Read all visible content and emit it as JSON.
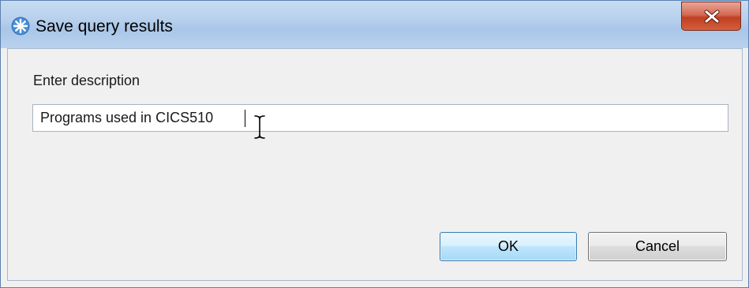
{
  "dialog": {
    "title": "Save query results",
    "icon": "asterisk-star-icon",
    "close_icon": "close-icon"
  },
  "form": {
    "description_label": "Enter description",
    "description_value": "Programs used in CICS510"
  },
  "buttons": {
    "ok_label": "OK",
    "cancel_label": "Cancel"
  },
  "colors": {
    "titlebar": "#b9d2ee",
    "close_button": "#c23f22",
    "ok_button_border": "#3c7fb1",
    "dialog_background": "#f0f0f0"
  }
}
